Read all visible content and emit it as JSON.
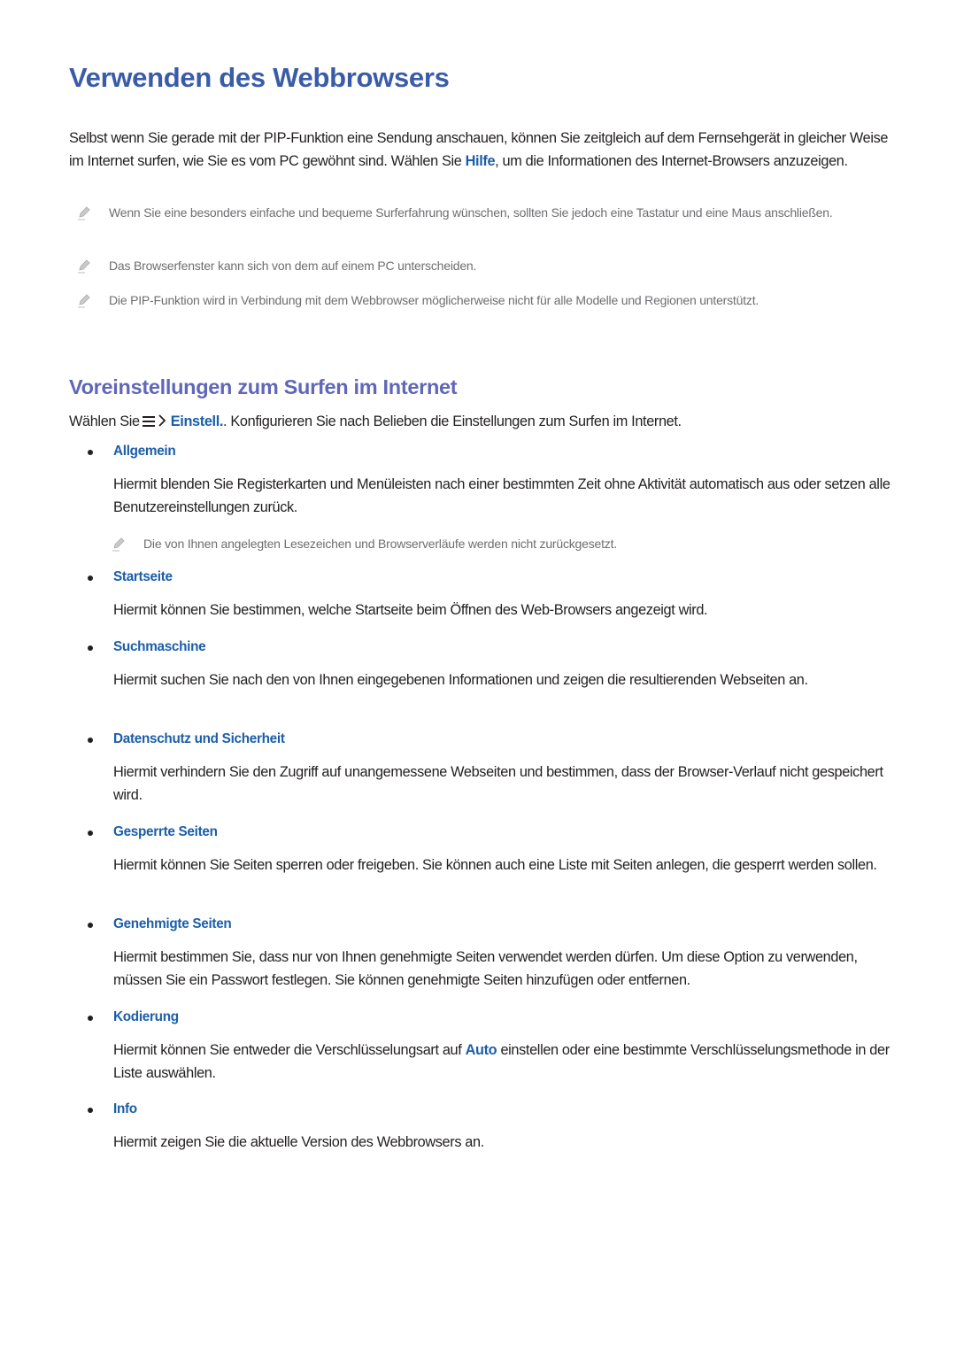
{
  "heading": "Verwenden des Webbrowsers",
  "intro": {
    "part1": "Selbst wenn Sie gerade mit der PIP-Funktion eine Sendung anschauen, können Sie zeitgleich auf dem Fernsehgerät in gleicher Weise im Internet surfen, wie Sie es vom PC gewöhnt sind. Wählen Sie ",
    "link": "Hilfe",
    "part2": ", um die Informationen des Internet-Browsers anzuzeigen."
  },
  "notes": [
    {
      "icon": "pencil-icon",
      "text": "Wenn Sie eine besonders einfache und bequeme Surferfahrung wünschen, sollten Sie jedoch eine Tastatur und eine Maus anschließen."
    },
    {
      "icon": "pencil-icon",
      "text": "Das Browserfenster kann sich von dem auf einem PC unterscheiden."
    },
    {
      "icon": "pencil-icon",
      "text": "Die PIP-Funktion wird in Verbindung mit dem Webbrowser möglicherweise nicht für alle Modelle und Regionen unterstützt."
    }
  ],
  "section": {
    "heading": "Voreinstellungen zum Surfen im Internet",
    "choose": {
      "prefix": "Wählen Sie",
      "menu_icon": "menu-icon",
      "chevron_icon": "chevron-right-icon",
      "link": "Einstell.",
      "suffix": ". Konfigurieren Sie nach Belieben die Einstellungen zum Surfen im Internet."
    },
    "items": [
      {
        "label": "Allgemein",
        "desc": "Hiermit blenden Sie Registerkarten und Menüleisten nach einer bestimmten Zeit ohne Aktivität automatisch aus oder setzen alle Benutzereinstellungen zurück.",
        "note": "Die von Ihnen angelegten Lesezeichen und Browserverläufe werden nicht zurückgesetzt."
      },
      {
        "label": "Startseite",
        "desc": "Hiermit können Sie bestimmen, welche Startseite beim Öffnen des Web-Browsers angezeigt wird."
      },
      {
        "label": "Suchmaschine",
        "desc": "Hiermit suchen Sie nach den von Ihnen eingegebenen Informationen und zeigen die resultierenden Webseiten an."
      },
      {
        "label": "Datenschutz und Sicherheit",
        "desc": "Hiermit verhindern Sie den Zugriff auf unangemessene Webseiten und bestimmen, dass der Browser-Verlauf nicht gespeichert wird."
      },
      {
        "label": "Gesperrte Seiten",
        "desc": "Hiermit können Sie Seiten sperren oder freigeben. Sie können auch eine Liste mit Seiten anlegen, die gesperrt werden sollen."
      },
      {
        "label": "Genehmigte Seiten",
        "desc": "Hiermit bestimmen Sie, dass nur von Ihnen genehmigte Seiten verwendet werden dürfen. Um diese Option zu verwenden, müssen Sie ein Passwort festlegen. Sie können genehmigte Seiten hinzufügen oder entfernen."
      },
      {
        "label": "Kodierung",
        "desc_part1": "Hiermit können Sie entweder die Verschlüsselungsart auf ",
        "desc_link": "Auto",
        "desc_part2": " einstellen oder eine bestimmte Verschlüsselungsmethode in der Liste auswählen."
      },
      {
        "label": "Info",
        "desc": "Hiermit zeigen Sie die aktuelle Version des Webbrowsers an."
      }
    ]
  },
  "colors": {
    "heading": "#3a5ca8",
    "subheading": "#6067b8",
    "keyword": "#1b5ea8",
    "body_text": "#231f20",
    "note_text": "#6d6e71"
  }
}
